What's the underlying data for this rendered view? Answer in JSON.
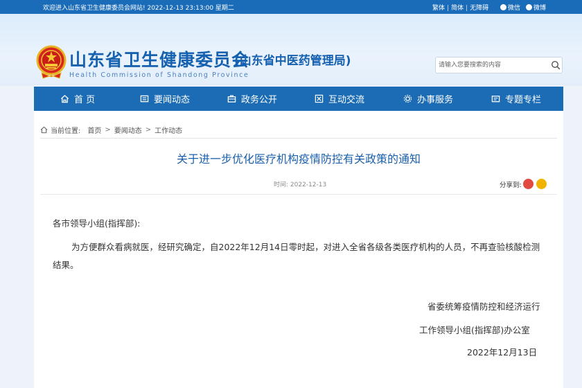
{
  "topbar": {
    "welcome": "欢迎进入山东省卫生健康委员会网站! 2022-12-13 23:13:00 星期二",
    "lang_traditional": "繁体",
    "lang_simplified": "简体",
    "accessibility": "无障碍",
    "wechat": "微信",
    "weibo": "微博"
  },
  "header": {
    "title": "山东省卫生健康委员会",
    "subtitle": "(山东省中医药管理局)",
    "english": "Health Commission of Shandong Province"
  },
  "search": {
    "placeholder": "请输入您要搜索的内容"
  },
  "nav": {
    "items": [
      {
        "label": "首 页",
        "icon": "home-icon"
      },
      {
        "label": "要闻动态",
        "icon": "news-icon"
      },
      {
        "label": "政务公开",
        "icon": "briefcase-icon"
      },
      {
        "label": "互动交流",
        "icon": "exchange-icon"
      },
      {
        "label": "办事服务",
        "icon": "gear-icon"
      },
      {
        "label": "专题专栏",
        "icon": "folder-icon"
      }
    ]
  },
  "breadcrumb": {
    "prefix": "当前位置:",
    "items": [
      "首页",
      "要闻动态",
      "工作动态"
    ]
  },
  "article": {
    "title": "关于进一步优化医疗机构疫情防控有关政策的通知",
    "time": "时间: 2022-12-13",
    "share_label": "分享到:",
    "greeting": "各市领导小组(指挥部):",
    "paragraph": "为方便群众看病就医，经研究确定，自2022年12月14日零时起，对进入全省各级各类医疗机构的人员，不再查验核酸检测结果。",
    "signature_line1": "省委统筹疫情防控和经济运行",
    "signature_line2": "工作领导小组(指挥部)办公室",
    "date": "2022年12月13日"
  },
  "colors": {
    "topbar": "#1a6bb8",
    "nav": "#1c6cb5",
    "title_blue": "#1661b0",
    "article_title": "#1a5fab"
  }
}
